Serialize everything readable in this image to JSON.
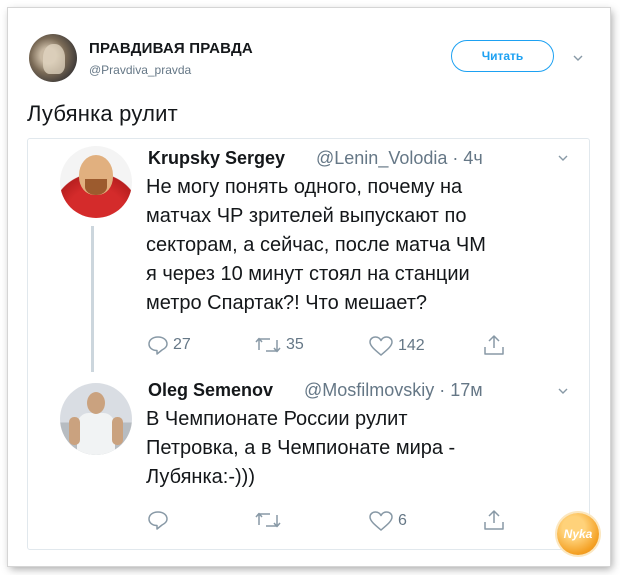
{
  "header": {
    "author_name": "ПРАВДИВАЯ ПРАВДА",
    "author_handle": "@Pravdiva_pravda",
    "follow_label": "Читать"
  },
  "tweet": {
    "text": "Лубянка рулит"
  },
  "replies": [
    {
      "name": "Krupsky Sergey",
      "handle": "@Lenin_Volodia · 4ч",
      "text": "Не могу понять одного, почему на\nматчах ЧР зрителей выпускают по\nсекторам, а сейчас, после матча ЧМ\nя через 10 минут стоял на станции\nметро Спартак?! Что мешает?",
      "reply_count": "27",
      "retweet_count": "35",
      "like_count": "142"
    },
    {
      "name": "Oleg Semenov",
      "handle": "@Mosfilmovskiy · 17м",
      "text": "В Чемпионате России рулит\nПетровка, а в Чемпионате мира -\nЛубянка:-)))",
      "reply_count": "",
      "retweet_count": "",
      "like_count": "6"
    }
  ],
  "watermark": {
    "text": "Nyka"
  },
  "colors": {
    "accent": "#1da1f2",
    "muted": "#657786",
    "border": "#e1e8ed"
  }
}
